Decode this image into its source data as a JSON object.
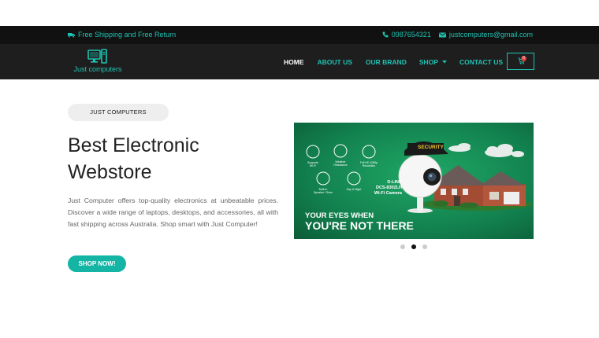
{
  "topbar": {
    "shipping_text": "Free Shipping and Free Return",
    "phone": "0987654321",
    "email": "justcomputers@gmail.com"
  },
  "header": {
    "logo_text": "Just computers",
    "nav": [
      {
        "label": "HOME",
        "active": true
      },
      {
        "label": "ABOUT US",
        "active": false
      },
      {
        "label": "OUR BRAND",
        "active": false
      },
      {
        "label": "SHOP",
        "active": false,
        "dropdown": true
      },
      {
        "label": "CONTACT US",
        "active": false
      }
    ],
    "cart_count": "0"
  },
  "hero": {
    "tag": "JUST COMPUTERS",
    "title_line1": "Best Electronic",
    "title_line2": "Webstore",
    "description": "Just Computer offers top-quality electronics at unbeatable prices. Discover a wide range of laptops, desktops, and accessories, all with fast shipping across Australia. Shop smart with Just Computer!",
    "cta_label": "SHOP NOW!"
  },
  "banner": {
    "product_line1": "D-LINK",
    "product_line2": "DCS-8302LH",
    "product_line3": "Wi-Fi Camera",
    "slogan_line1": "YOUR EYES WHEN",
    "slogan_line2": "YOU'RE NOT THERE",
    "cap_text": "SECURITY",
    "features": [
      {
        "label1": "Supports",
        "label2": "Wi-Fi"
      },
      {
        "label1": "Weather",
        "label2": "Resistance"
      },
      {
        "label1": "Full HD 1080p",
        "label2": "Resolution"
      },
      {
        "label1": "Built-in",
        "label2": "Speaker / Siren"
      },
      {
        "label1": "Day & Night",
        "label2": ""
      }
    ]
  },
  "carousel": {
    "slides": 3,
    "active_index": 1
  },
  "colors": {
    "accent": "#1ec2b3",
    "button": "#15b5a6",
    "topbar_bg": "#111111",
    "navbar_bg": "#1e1e1e",
    "banner_green": "#12804e"
  },
  "icons": {
    "shipping": "truck-icon",
    "phone": "phone-icon",
    "email": "envelope-icon",
    "logo": "computer-icon",
    "cart": "cart-icon",
    "dropdown": "caret-down-icon"
  }
}
